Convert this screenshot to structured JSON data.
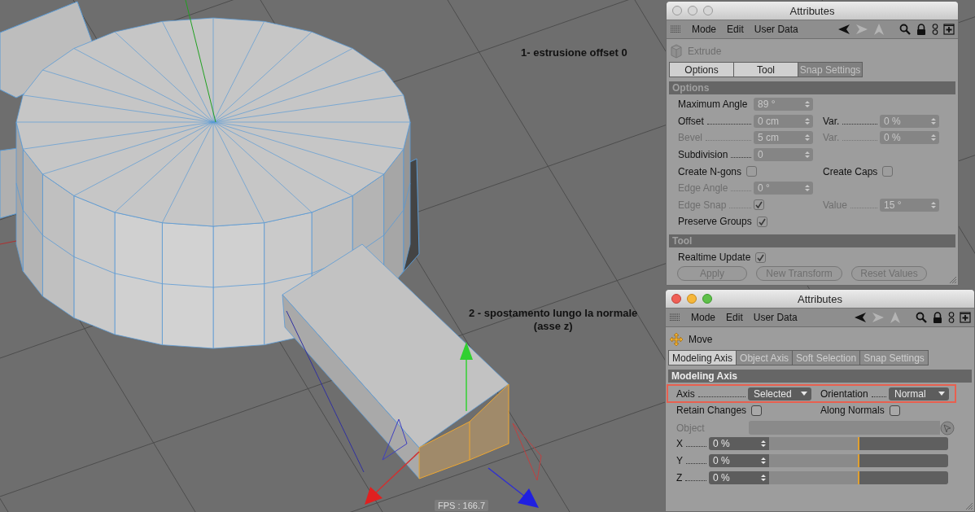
{
  "viewport": {
    "annotations": [
      {
        "lines": [
          "1- estrusione offset 0"
        ]
      },
      {
        "lines": [
          "2 - spostamento lungo la normale",
          "(asse z)"
        ]
      }
    ],
    "fps": "FPS : 166.7"
  },
  "windows": [
    {
      "title": "Attributes",
      "active": false,
      "menu": [
        "Mode",
        "Edit",
        "User Data"
      ],
      "tool": {
        "kind": "extrude",
        "name": "Extrude"
      },
      "tabs": [
        {
          "label": "Options",
          "selected": true
        },
        {
          "label": "Tool",
          "selected": true
        },
        {
          "label": "Snap Settings",
          "selected": false
        }
      ],
      "sections": [
        {
          "title": "Options",
          "rows": [
            {
              "highlighted": false,
              "cells": [
                {
                  "kind": "number",
                  "label": "Maximum Angle",
                  "value": "89 °",
                  "leader": false,
                  "disabled": false
                }
              ]
            },
            {
              "highlighted": false,
              "cells": [
                {
                  "kind": "number",
                  "label": "Offset",
                  "value": "0 cm",
                  "leader": true,
                  "disabled": false
                },
                {
                  "kind": "number",
                  "label": "Var.",
                  "value": "0 %",
                  "leader": true,
                  "disabled": false
                }
              ]
            },
            {
              "highlighted": false,
              "cells": [
                {
                  "kind": "number",
                  "label": "Bevel",
                  "value": "5 cm",
                  "leader": true,
                  "disabled": true
                },
                {
                  "kind": "number",
                  "label": "Var.",
                  "value": "0 %",
                  "leader": true,
                  "disabled": true
                }
              ]
            },
            {
              "highlighted": false,
              "cells": [
                {
                  "kind": "number",
                  "label": "Subdivision",
                  "value": "0",
                  "leader": true,
                  "disabled": false
                }
              ]
            },
            {
              "highlighted": false,
              "cells": [
                {
                  "kind": "checkbox",
                  "label": "Create N-gons",
                  "checked": false,
                  "leader": false,
                  "disabled": false
                },
                {
                  "kind": "checkbox",
                  "label": "Create Caps",
                  "checked": false,
                  "leader": false,
                  "disabled": false
                }
              ]
            },
            {
              "highlighted": false,
              "cells": [
                {
                  "kind": "number",
                  "label": "Edge Angle",
                  "value": "0 °",
                  "leader": true,
                  "disabled": true
                }
              ]
            },
            {
              "highlighted": false,
              "cells": [
                {
                  "kind": "checkbox",
                  "label": "Edge Snap",
                  "checked": true,
                  "leader": true,
                  "disabled": true
                },
                {
                  "kind": "number",
                  "label": "Value",
                  "value": "15 °",
                  "leader": true,
                  "disabled": true
                }
              ]
            },
            {
              "highlighted": false,
              "cells": [
                {
                  "kind": "checkbox",
                  "label": "Preserve Groups",
                  "checked": true,
                  "leader": false,
                  "disabled": false
                }
              ]
            }
          ]
        },
        {
          "title": "Tool",
          "rows": [
            {
              "highlighted": false,
              "cells": [
                {
                  "kind": "checkbox",
                  "label": "Realtime Update",
                  "checked": true,
                  "leader": false,
                  "disabled": false
                }
              ]
            }
          ]
        }
      ],
      "buttons": [
        "Apply",
        "New Transform",
        "Reset Values"
      ]
    },
    {
      "title": "Attributes",
      "active": true,
      "menu": [
        "Mode",
        "Edit",
        "User Data"
      ],
      "tool": {
        "kind": "move",
        "name": "Move"
      },
      "tabs": [
        {
          "label": "Modeling Axis",
          "selected": true
        },
        {
          "label": "Object Axis",
          "selected": false
        },
        {
          "label": "Soft Selection",
          "selected": false
        },
        {
          "label": "Snap Settings",
          "selected": false
        }
      ],
      "sections": [
        {
          "title": "Modeling Axis",
          "rows": [
            {
              "highlighted": true,
              "cells": [
                {
                  "kind": "dropdown",
                  "label": "Axis",
                  "value": "Selected",
                  "leader": true,
                  "disabled": false
                },
                {
                  "kind": "dropdown",
                  "label": "Orientation",
                  "value": "Normal",
                  "leader": true,
                  "disabled": false
                }
              ]
            },
            {
              "highlighted": false,
              "cells": [
                {
                  "kind": "checkbox",
                  "label": "Retain Changes",
                  "checked": false,
                  "leader": false,
                  "disabled": false
                },
                {
                  "kind": "checkbox",
                  "label": "Along Normals",
                  "checked": false,
                  "leader": false,
                  "disabled": false
                }
              ]
            },
            {
              "highlighted": false,
              "cells": [
                {
                  "kind": "link",
                  "label": "Object",
                  "leader": false,
                  "disabled": true
                }
              ]
            },
            {
              "highlighted": false,
              "cells": [
                {
                  "kind": "slider",
                  "label": "X",
                  "value": "0 %",
                  "level": 0.5,
                  "leader": true,
                  "disabled": false
                }
              ]
            },
            {
              "highlighted": false,
              "cells": [
                {
                  "kind": "slider",
                  "label": "Y",
                  "value": "0 %",
                  "level": 0.5,
                  "leader": true,
                  "disabled": false
                }
              ]
            },
            {
              "highlighted": false,
              "cells": [
                {
                  "kind": "slider",
                  "label": "Z",
                  "value": "0 %",
                  "level": 0.5,
                  "leader": true,
                  "disabled": false
                }
              ]
            }
          ]
        }
      ]
    }
  ]
}
